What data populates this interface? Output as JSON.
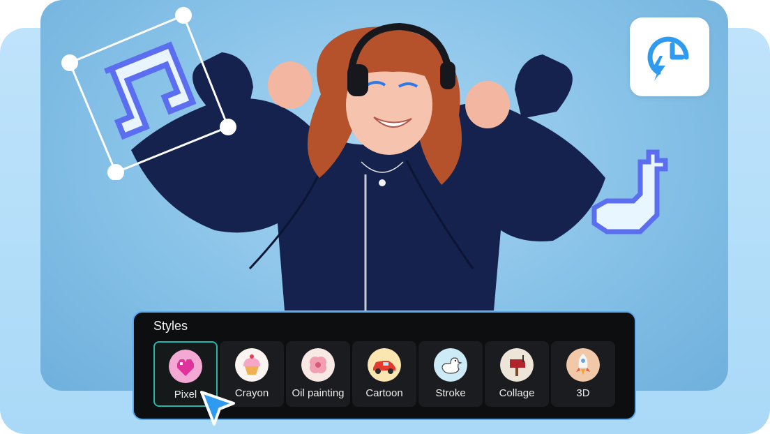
{
  "styles_panel": {
    "title": "Styles",
    "selected": "Pixel",
    "items": [
      {
        "label": "Pixel",
        "icon": "pixel-heart-icon"
      },
      {
        "label": "Crayon",
        "icon": "cupcake-icon"
      },
      {
        "label": "Oil painting",
        "icon": "flower-icon"
      },
      {
        "label": "Cartoon",
        "icon": "red-car-icon"
      },
      {
        "label": "Stroke",
        "icon": "duck-icon"
      },
      {
        "label": "Collage",
        "icon": "mailbox-icon"
      },
      {
        "label": "3D",
        "icon": "rocket-icon"
      }
    ]
  },
  "icons": {
    "badge": "lightning-clock-icon",
    "note_left": "pixel-music-note-icon",
    "note_right": "pixel-music-note-icon",
    "cursor": "cursor-arrow-icon"
  },
  "colors": {
    "accent_blue": "#2f9bf0",
    "note_outline": "#5b6ef0",
    "panel_bg": "#0d0e10",
    "selected_border": "#25b7ad"
  }
}
